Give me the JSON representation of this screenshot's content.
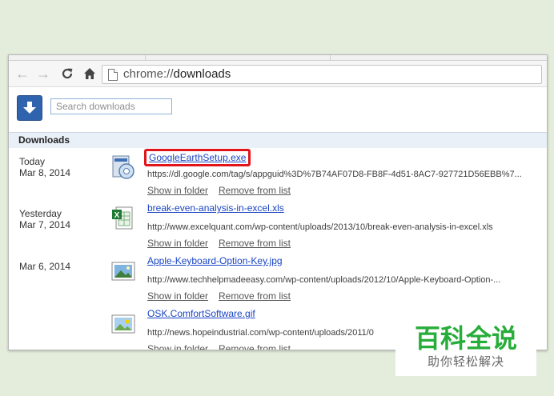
{
  "browser": {
    "url_scheme": "chrome://",
    "url_path": "downloads"
  },
  "page": {
    "search_placeholder": "Search downloads",
    "section_title": "Downloads"
  },
  "downloads": [
    {
      "date_label": "Today",
      "date": "Mar 8, 2014",
      "file_name": "GoogleEarthSetup.exe",
      "url": "https://dl.google.com/tag/s/appguid%3D%7B74AF07D8-FB8F-4d51-8AC7-927721D56EBB%7...",
      "show_in_folder": "Show in folder",
      "remove": "Remove from list",
      "highlighted": true
    },
    {
      "date_label": "Yesterday",
      "date": "Mar 7, 2014",
      "file_name": "break-even-analysis-in-excel.xls",
      "url": "http://www.excelquant.com/wp-content/uploads/2013/10/break-even-analysis-in-excel.xls",
      "show_in_folder": "Show in folder",
      "remove": "Remove from list"
    },
    {
      "date_label": "",
      "date": "Mar 6, 2014",
      "file_name": "Apple-Keyboard-Option-Key.jpg",
      "url": "http://www.techhelpmadeeasy.com/wp-content/uploads/2012/10/Apple-Keyboard-Option-...",
      "show_in_folder": "Show in folder",
      "remove": "Remove from list"
    },
    {
      "date_label": "",
      "date": "",
      "file_name": "OSK.ComfortSoftware.gif",
      "url": "http://news.hopeindustrial.com/wp-content/uploads/2011/0",
      "show_in_folder": "Show in folder",
      "remove": "Remove from list"
    }
  ],
  "watermark": {
    "title": "百科全说",
    "subtitle": "助你轻松解决"
  },
  "colors": {
    "link": "#1a44c4",
    "highlight_border": "#e1141b",
    "download_button": "#2f63ad",
    "watermark_green": "#27ad3a"
  }
}
